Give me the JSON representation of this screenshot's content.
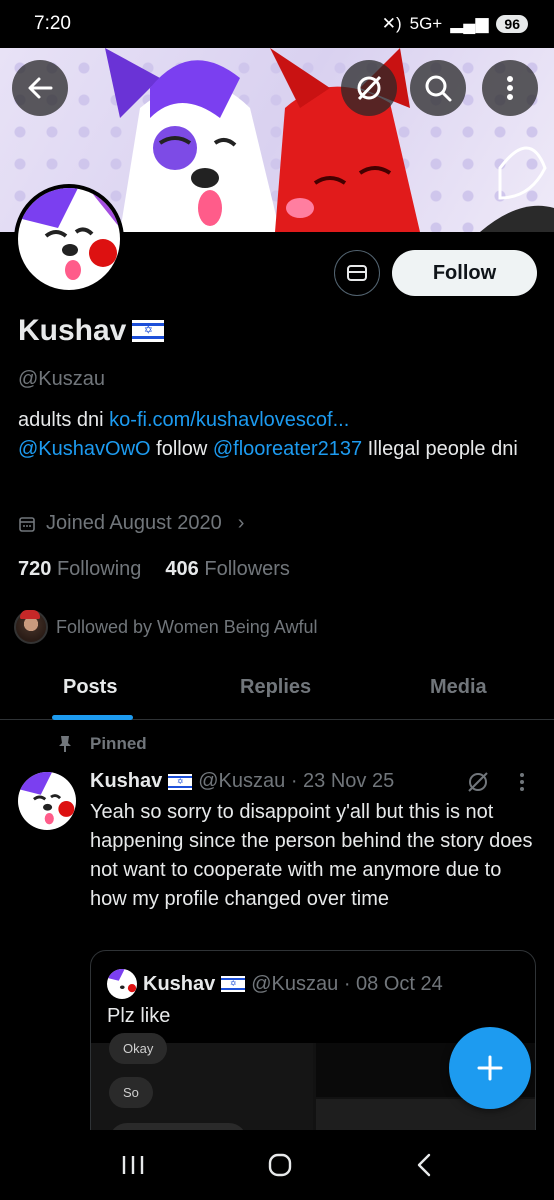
{
  "status": {
    "time": "7:20",
    "network": "5G+",
    "battery": "96"
  },
  "profile": {
    "name": "Kushav",
    "handle": "@Kuszau",
    "bio_prefix": "adults dni ",
    "bio_link": "ko-fi.com/kushavlovescof...",
    "bio_mention1": "@KushavOwO",
    "bio_mid": " follow ",
    "bio_mention2": "@flooreater2137",
    "bio_suffix": "  Illegal people dni",
    "joined": "Joined August 2020",
    "following_count": "720",
    "following_label": "Following",
    "followers_count": "406",
    "followers_label": "Followers",
    "followed_by": "Followed by Women Being Awful"
  },
  "actions": {
    "follow_label": "Follow"
  },
  "tabs": [
    {
      "label": "Posts"
    },
    {
      "label": "Replies"
    },
    {
      "label": "Media"
    }
  ],
  "post": {
    "pinned_label": "Pinned",
    "author": "Kushav",
    "handle_date": "@Kuszau · 23 Nov 25",
    "text": "Yeah so sorry to disappoint y'all but this is not happening since the person behind the story does not want to cooperate with me anymore due to how my profile changed over time",
    "quote": {
      "author": "Kushav",
      "handle_date": "@Kuszau · 08 Oct 24",
      "text": "Plz like",
      "chips": [
        "Okay",
        "So"
      ]
    }
  },
  "colors": {
    "accent": "#1d9bf0",
    "background": "#000000",
    "muted": "#71767b"
  }
}
